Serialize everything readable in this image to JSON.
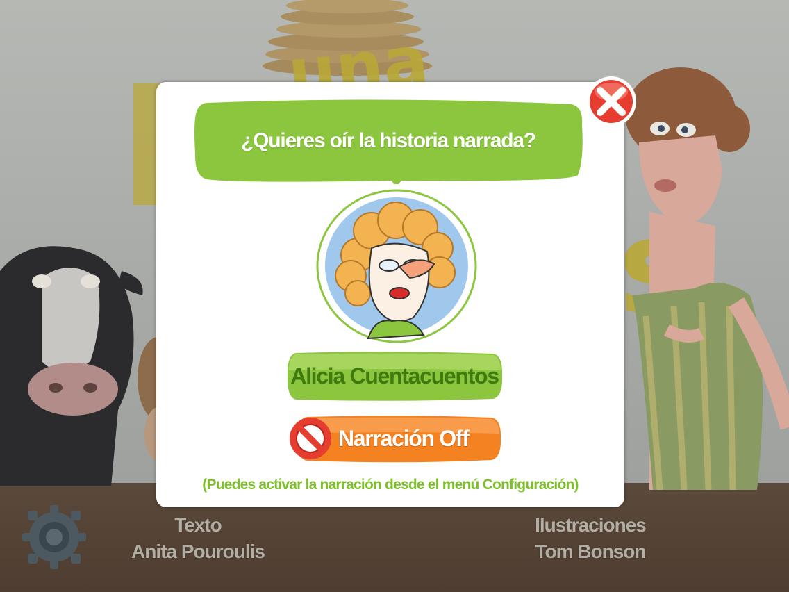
{
  "dialog": {
    "question": "¿Quieres oír la historia narrada?",
    "narrator_button_label": "Alicia Cuentacuentos",
    "narration_off_label": "Narración Off",
    "hint": "(Puedes activar la narración desde el menú Configuración)",
    "close_icon": "close-x-icon",
    "no_icon": "prohibited-icon"
  },
  "background": {
    "title_fragments": [
      "una",
      "s"
    ],
    "credits": {
      "text_label": "Texto",
      "text_author": "Anita Pouroulis",
      "illustrations_label": "Ilustraciones",
      "illustrations_author": "Tom Bonson"
    },
    "settings_icon": "gear-icon"
  },
  "colors": {
    "green": "#8cc63f",
    "green_text": "#3f7a0e",
    "orange": "#f58220",
    "red": "#e53d2f"
  }
}
